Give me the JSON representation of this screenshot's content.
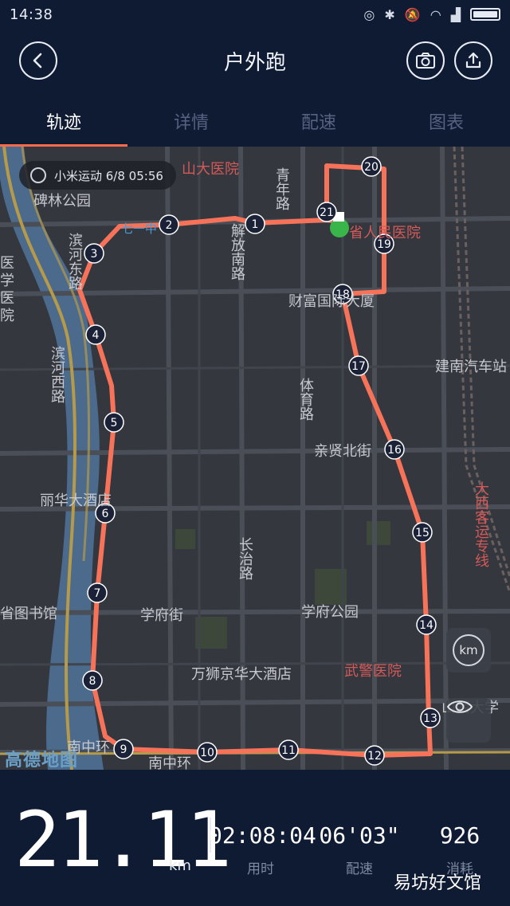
{
  "status_bar": {
    "time": "14:38",
    "icons": [
      "location-icon",
      "bluetooth-icon",
      "mute-icon",
      "wifi-icon",
      "signal-icon",
      "battery-icon"
    ]
  },
  "header": {
    "title": "户外跑",
    "back_icon": "back-arrow-icon",
    "camera_icon": "camera-icon",
    "share_icon": "share-icon"
  },
  "tabs": [
    {
      "label": "轨迹",
      "active": true
    },
    {
      "label": "详情",
      "active": false
    },
    {
      "label": "配速",
      "active": false
    },
    {
      "label": "图表",
      "active": false
    }
  ],
  "map": {
    "info_chip": "小米运动 6/8 05:56",
    "km_button": "km",
    "logo": "高德地图",
    "labels": {
      "hospital_top": "山大医院",
      "stele_park": "碑林公园",
      "qingnian_road": "青年路",
      "jiefang_road": "解放南路",
      "provincial_hospital": "省人民医院",
      "binhe_road": "滨河东路",
      "medical": "医学医院",
      "caifu": "财富国际大厦",
      "binhe_west": "滨河西路",
      "tiyu_road": "体育路",
      "jiannan_station": "建南汽车站",
      "qinxian_street": "亲贤北街",
      "lihua_hotel": "丽华大酒店",
      "xikeyun_line": "大西客运专线",
      "changzhi_road": "长治路",
      "library": "省图书馆",
      "xuefu_street": "学府街",
      "xuefu_park": "学府公园",
      "wanshi_hotel": "万狮京华大酒店",
      "wujing_hospital": "武警医院",
      "shanxi_univ": "山西大学",
      "nanzhong": "南中环",
      "nanzhonghuan_right": "南中环",
      "sign_left": "七一中"
    },
    "markers": [
      "1",
      "2",
      "3",
      "4",
      "5",
      "6",
      "7",
      "8",
      "9",
      "10",
      "11",
      "12",
      "13",
      "14",
      "15",
      "16",
      "17",
      "18",
      "19",
      "20",
      "21"
    ],
    "route_color": "#f6735a",
    "marker_color": "#1b2238"
  },
  "stats": {
    "distance": "21.11",
    "distance_unit": "km",
    "duration": "02:08:04",
    "duration_label": "用时",
    "pace": "06'03\"",
    "pace_label": "配速",
    "calories": "926",
    "calories_label": "消耗",
    "watermark": "易坊好文馆"
  }
}
